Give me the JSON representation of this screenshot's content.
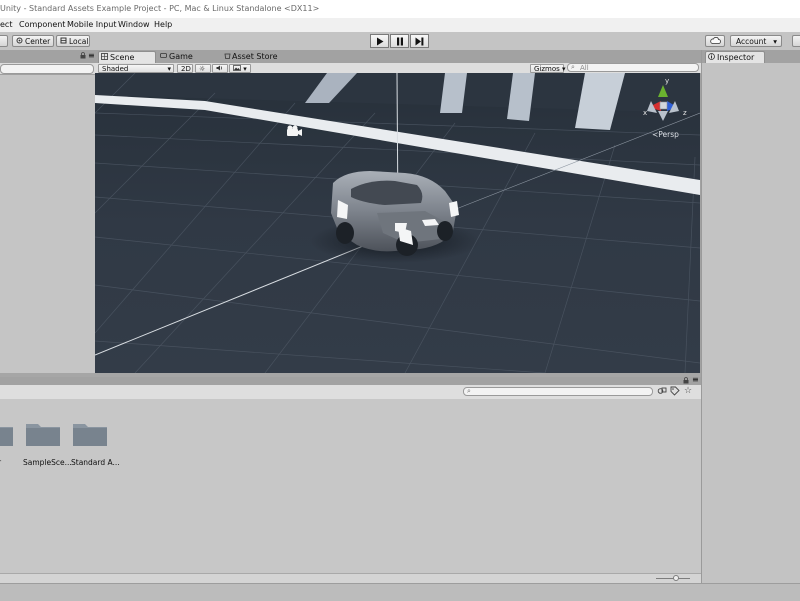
{
  "window": {
    "title": "Unity - Standard Assets Example Project - PC, Mac & Linux Standalone <DX11>"
  },
  "menu": [
    "ect",
    "Component",
    "Mobile Input",
    "Window",
    "Help"
  ],
  "toolbar": {
    "pivot_label": "Center",
    "space_label": "Local",
    "account_label": "Account"
  },
  "scene": {
    "tabs": [
      "Scene",
      "Game",
      "Asset Store"
    ],
    "shading_mode": "Shaded",
    "mode_2d": "2D",
    "gizmos_label": "Gizmos",
    "search_placeholder": "All",
    "orientation_label": "Persp",
    "axes": {
      "x": "x",
      "y": "y",
      "z": "z"
    }
  },
  "inspector": {
    "tab": "Inspector"
  },
  "project": {
    "folders": [
      {
        "label": "r"
      },
      {
        "label": "SampleSce..."
      },
      {
        "label": "Standard A..."
      }
    ]
  },
  "colors": {
    "toolbar": "#c4c4c4",
    "panel": "#c2c2c2",
    "folder": "#7f8b96",
    "scene_ground": "#2f3843",
    "gizmo_x": "#d62f2f",
    "gizmo_y": "#6bb32f",
    "gizmo_z": "#2f5fd6"
  }
}
